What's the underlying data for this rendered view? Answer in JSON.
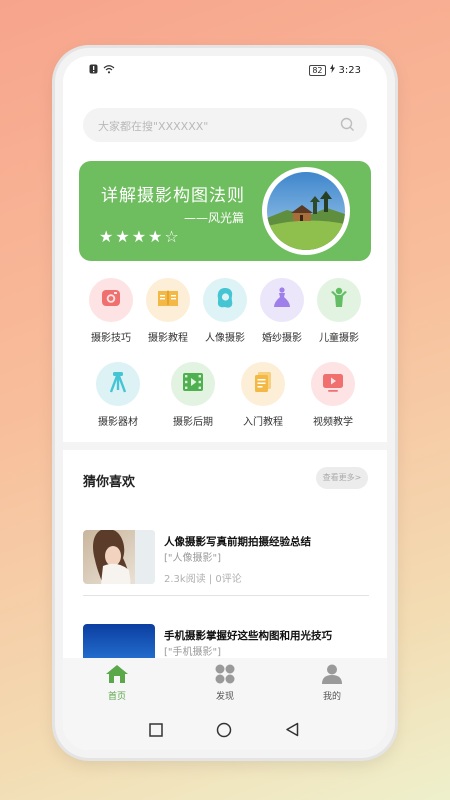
{
  "status_bar": {
    "battery": "82",
    "time": "3:23"
  },
  "search": {
    "placeholder": "大家都在搜\"XXXXXX\""
  },
  "banner": {
    "title": "详解摄影构图法则",
    "subtitle": "——风光篇",
    "stars": "★★★★☆",
    "rating": 4,
    "rating_max": 5
  },
  "categories_row1": [
    {
      "label": "摄影技巧",
      "icon": "camera-icon",
      "bg": "#fde3e3",
      "color": "#f07070"
    },
    {
      "label": "摄影教程",
      "icon": "book-icon",
      "bg": "#fdefd7",
      "color": "#f4b945"
    },
    {
      "label": "人像摄影",
      "icon": "portrait-icon",
      "bg": "#ddf3f5",
      "color": "#45c5d4"
    },
    {
      "label": "婚纱摄影",
      "icon": "wedding-dress-icon",
      "bg": "#ebe6fa",
      "color": "#9f80ea"
    },
    {
      "label": "儿童摄影",
      "icon": "child-icon",
      "bg": "#e2f3e2",
      "color": "#63bd63"
    }
  ],
  "categories_row2": [
    {
      "label": "摄影器材",
      "icon": "tripod-icon",
      "bg": "#dcf2f5",
      "color": "#45c5d4"
    },
    {
      "label": "摄影后期",
      "icon": "film-icon",
      "bg": "#e2f3e2",
      "color": "#4fb04f"
    },
    {
      "label": "入门教程",
      "icon": "document-icon",
      "bg": "#fdefd7",
      "color": "#f4b945"
    },
    {
      "label": "视频教学",
      "icon": "video-icon",
      "bg": "#fde3e3",
      "color": "#f07070"
    }
  ],
  "section": {
    "title": "猜你喜欢",
    "more_label": "查看更多>"
  },
  "articles": [
    {
      "title": "人像摄影写真前期拍摄经验总结",
      "tag": "[\"人像摄影\"]",
      "meta": "2.3k阅读 | 0评论"
    },
    {
      "title": "手机摄影掌握好这些构图和用光技巧",
      "tag": "[\"手机摄影\"]",
      "meta": ""
    }
  ],
  "tabs": [
    {
      "label": "首页",
      "icon": "home-icon"
    },
    {
      "label": "发现",
      "icon": "grid-icon"
    },
    {
      "label": "我的",
      "icon": "user-icon"
    }
  ],
  "colors": {
    "accent": "#6ebd5e",
    "tab_active": "#5aa84a",
    "tab_inactive": "#555555"
  }
}
